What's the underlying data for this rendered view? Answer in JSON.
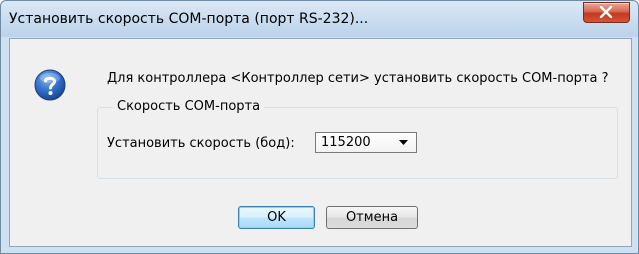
{
  "window": {
    "title": "Установить скорость COM-порта (порт RS-232)..."
  },
  "dialog": {
    "message": "Для контроллера <Контроллер сети> установить скорость COM-порта ?",
    "icon": "question-icon",
    "group": {
      "legend": "Скорость COM-порта",
      "speed_label": "Установить скорость (бод):",
      "speed_value": "115200"
    },
    "buttons": {
      "ok": "OK",
      "cancel": "Отмена"
    }
  },
  "colors": {
    "titlebar": "#c9dcef",
    "close_button": "#c2391e",
    "client_bg": "#f0f0f0",
    "ok_border": "#3c7fb1"
  }
}
